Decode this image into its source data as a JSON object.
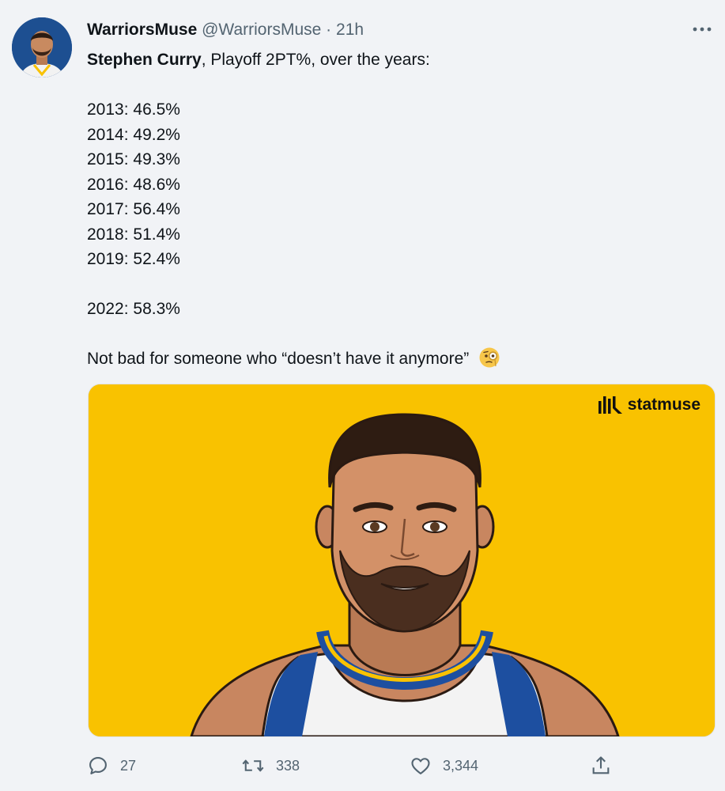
{
  "tweet": {
    "display_name": "WarriorsMuse",
    "handle": "@WarriorsMuse",
    "separator": "·",
    "time": "21h",
    "more_label": "···",
    "intro_bold": "Stephen Curry",
    "intro_rest": ", Playoff 2PT%, over the years:",
    "stats": [
      "2013: 46.5%",
      "2014: 49.2%",
      "2015: 49.3%",
      "2016: 48.6%",
      "2017: 56.4%",
      "2018: 51.4%",
      "2019: 52.4%"
    ],
    "stat_2022": "2022: 58.3%",
    "closing": "Not bad for someone who “doesn’t have it anymore”",
    "closing_emoji": "face-with-monocle-icon"
  },
  "media": {
    "brand": "statmuse",
    "background_color": "#f9c200"
  },
  "actions": {
    "replies": "27",
    "retweets": "338",
    "likes": "3,344"
  }
}
